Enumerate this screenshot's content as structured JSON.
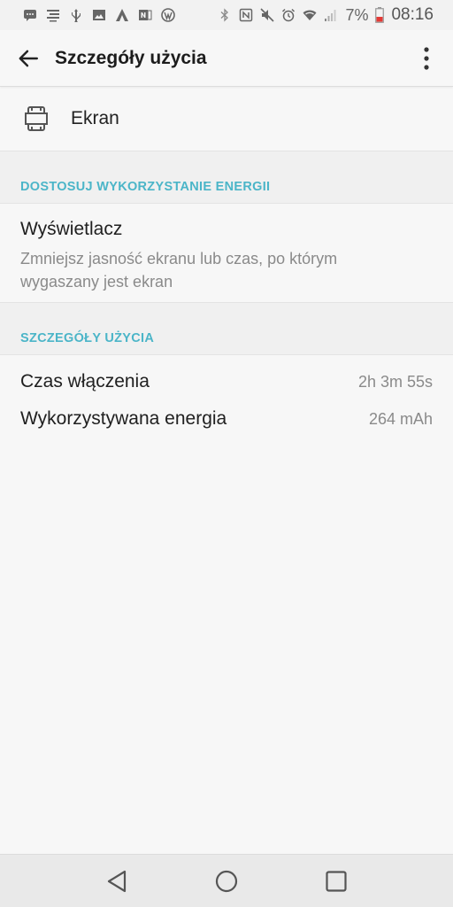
{
  "status_bar": {
    "battery_percent": "7%",
    "time": "08:16",
    "left_icons": [
      "messages-icon",
      "notes-icon",
      "usb-icon",
      "gallery-icon",
      "app-a-icon",
      "onenote-icon",
      "wordpress-icon"
    ],
    "right_icons": [
      "bluetooth-icon",
      "nfc-icon",
      "mute-icon",
      "alarm-icon",
      "wifi-icon",
      "signal-icon",
      "battery-icon"
    ],
    "battery_color": "#e53935"
  },
  "app_bar": {
    "title": "Szczegóły użycia",
    "back_icon": "arrow-back-icon",
    "more_icon": "more-vert-icon"
  },
  "app_row": {
    "icon": "screen-icon",
    "label": "Ekran"
  },
  "sections": [
    {
      "header": "DOSTOSUJ WYKORZYSTANIE ENERGII",
      "items": [
        {
          "title": "Wyświetlacz",
          "summary": "Zmniejsz jasność ekranu lub czas, po którym wygaszany jest ekran"
        }
      ]
    },
    {
      "header": "SZCZEGÓŁY UŻYCIA",
      "rows": [
        {
          "label": "Czas włączenia",
          "value": "2h 3m 55s"
        },
        {
          "label": "Wykorzystywana energia",
          "value": "264 mAh"
        }
      ]
    }
  ],
  "nav_bar": {
    "icons": [
      "back-triangle-icon",
      "home-circle-icon",
      "recents-square-icon"
    ]
  },
  "colors": {
    "accent": "#4bb5c8",
    "background": "#f7f7f7",
    "section_background": "#f0f0f0",
    "secondary_text": "#8a8a8a"
  }
}
